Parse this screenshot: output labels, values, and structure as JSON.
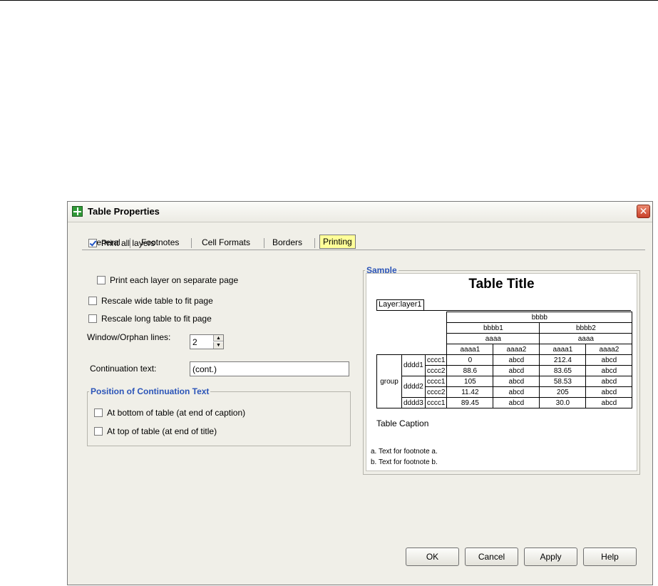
{
  "dialog": {
    "title": "Table Properties",
    "close_glyph": "✕"
  },
  "tabs": [
    {
      "label": "General"
    },
    {
      "label": "Footnotes"
    },
    {
      "label": "Cell Formats"
    },
    {
      "label": "Borders"
    },
    {
      "label": "Printing",
      "selected": true
    }
  ],
  "options": {
    "print_all_layers": {
      "label": "Print all layers",
      "checked": true
    },
    "print_each_layer": {
      "label": "Print each layer on separate page",
      "checked": false
    },
    "rescale_wide": {
      "label": "Rescale wide table to fit page",
      "checked": false
    },
    "rescale_long": {
      "label": "Rescale long table to fit page",
      "checked": false
    }
  },
  "window_orphan": {
    "label": "Window/Orphan lines:",
    "value": "2"
  },
  "continuation": {
    "label": "Continuation text:",
    "value": "(cont.)"
  },
  "position_group": {
    "title": "Position of Continuation Text",
    "bottom": {
      "label": "At bottom of table (at end of caption)",
      "checked": false
    },
    "top": {
      "label": "At top of table (at end of title)",
      "checked": false
    }
  },
  "sample": {
    "group_title": "Sample",
    "table_title": "Table Title",
    "layer": "Layer:layer1",
    "header": {
      "b": "bbbb",
      "b1": "bbbb1",
      "b2": "bbbb2",
      "a_left": "aaaa",
      "a_right": "aaaa",
      "cols": [
        "aaaa1",
        "aaaa2",
        "aaaa1",
        "aaaa2"
      ]
    },
    "row_group": "group",
    "d1": "dddd1",
    "d2": "dddd2",
    "d3": "dddd3",
    "rows": [
      {
        "c": "cccc1",
        "v": [
          "0",
          "abcd",
          "212.4",
          "abcd"
        ]
      },
      {
        "c": "cccc2",
        "v": [
          "88.6",
          "abcd",
          "83.65",
          "abcd"
        ]
      },
      {
        "c": "cccc1",
        "v": [
          "105",
          "abcd",
          "58.53",
          "abcd"
        ]
      },
      {
        "c": "cccc2",
        "v": [
          "11.42",
          "abcd",
          "205",
          "abcd"
        ]
      },
      {
        "c": "cccc1",
        "v": [
          "89.45",
          "abcd",
          "30.0",
          "abcd"
        ]
      }
    ],
    "caption": "Table Caption",
    "footnote_a": "a. Text for footnote a.",
    "footnote_b": "b. Text for footnote b."
  },
  "buttons": {
    "ok": "OK",
    "cancel": "Cancel",
    "apply": "Apply",
    "help": "Help"
  }
}
